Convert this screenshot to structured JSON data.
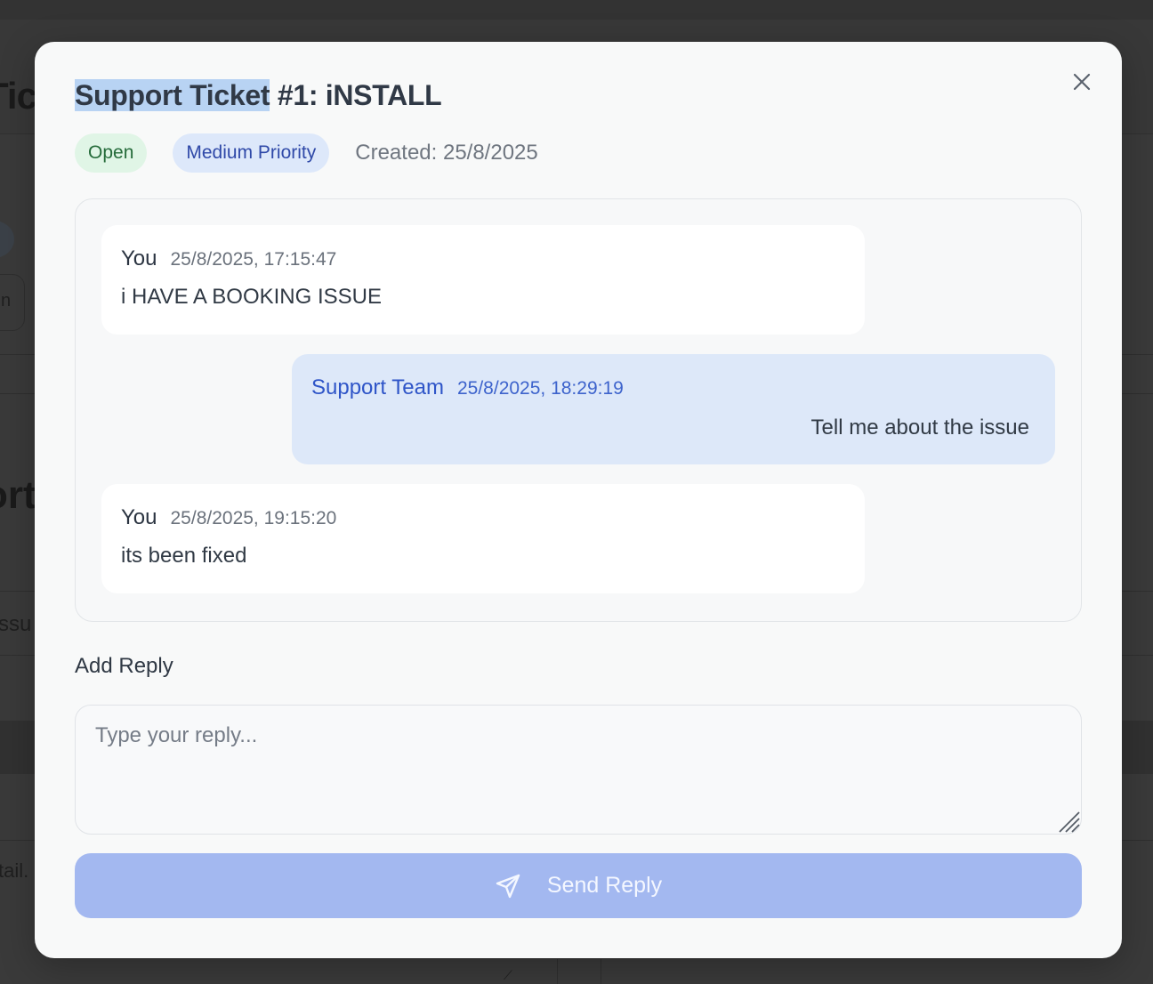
{
  "background": {
    "title_fragment": "Tic",
    "section_title_fragment": "ort",
    "issue_fragment": "ssu",
    "detail_fragment": "tail.",
    "pill_fragment": "n"
  },
  "modal": {
    "title_highlighted": "Support Ticket",
    "title_rest": " #1: iNSTALL",
    "close_icon": "close-icon",
    "status_badge": "Open",
    "priority_badge": "Medium Priority",
    "created": "Created: 25/8/2025",
    "messages": [
      {
        "author": "You",
        "time": "25/8/2025, 17:15:47",
        "body": "i HAVE A BOOKING ISSUE",
        "from": "user"
      },
      {
        "author": "Support Team",
        "time": "25/8/2025, 18:29:19",
        "body": "Tell me about the issue",
        "from": "support"
      },
      {
        "author": "You",
        "time": "25/8/2025, 19:15:20",
        "body": "its been fixed",
        "from": "user"
      }
    ],
    "reply": {
      "label": "Add Reply",
      "placeholder": "Type your reply...",
      "value": ""
    },
    "send_button": {
      "label": "Send Reply",
      "icon": "send-icon"
    }
  },
  "colors": {
    "status_open_bg": "#e0f5e6",
    "priority_bg": "#dde8fa",
    "support_bubble": "#dde8f9",
    "send_button": "#a3b8f0"
  }
}
